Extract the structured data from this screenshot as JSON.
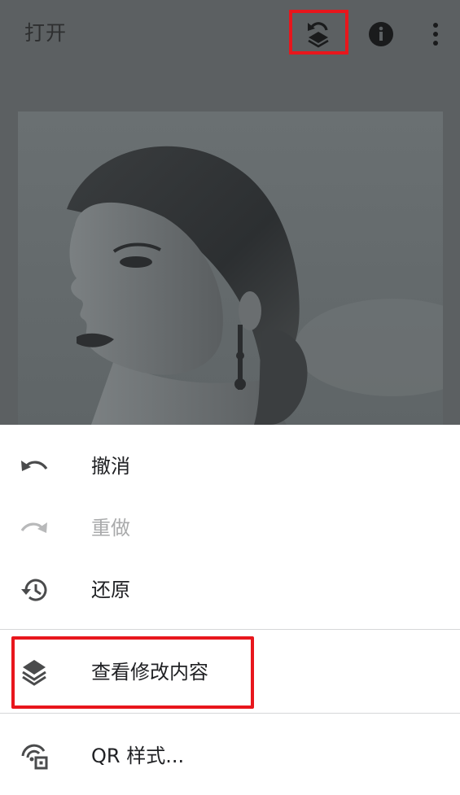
{
  "toolbar": {
    "open_label": "打开",
    "icons": [
      "stack-undo-icon",
      "info-icon",
      "more-vert-icon"
    ]
  },
  "photo": {
    "description_icon": "portrait-photo"
  },
  "menu": {
    "items": [
      {
        "label": "撤消",
        "icon": "undo-icon",
        "enabled": true
      },
      {
        "label": "重做",
        "icon": "redo-icon",
        "enabled": false
      },
      {
        "label": "还原",
        "icon": "history-icon",
        "enabled": true
      },
      {
        "label": "查看修改内容",
        "icon": "layers-icon",
        "enabled": true
      },
      {
        "label": "QR 样式...",
        "icon": "qr-style-icon",
        "enabled": true
      }
    ]
  },
  "colors": {
    "highlight": "#e8161c",
    "scrim": "#5c6062",
    "text": "#202124",
    "disabled_text": "#a9aaab"
  }
}
